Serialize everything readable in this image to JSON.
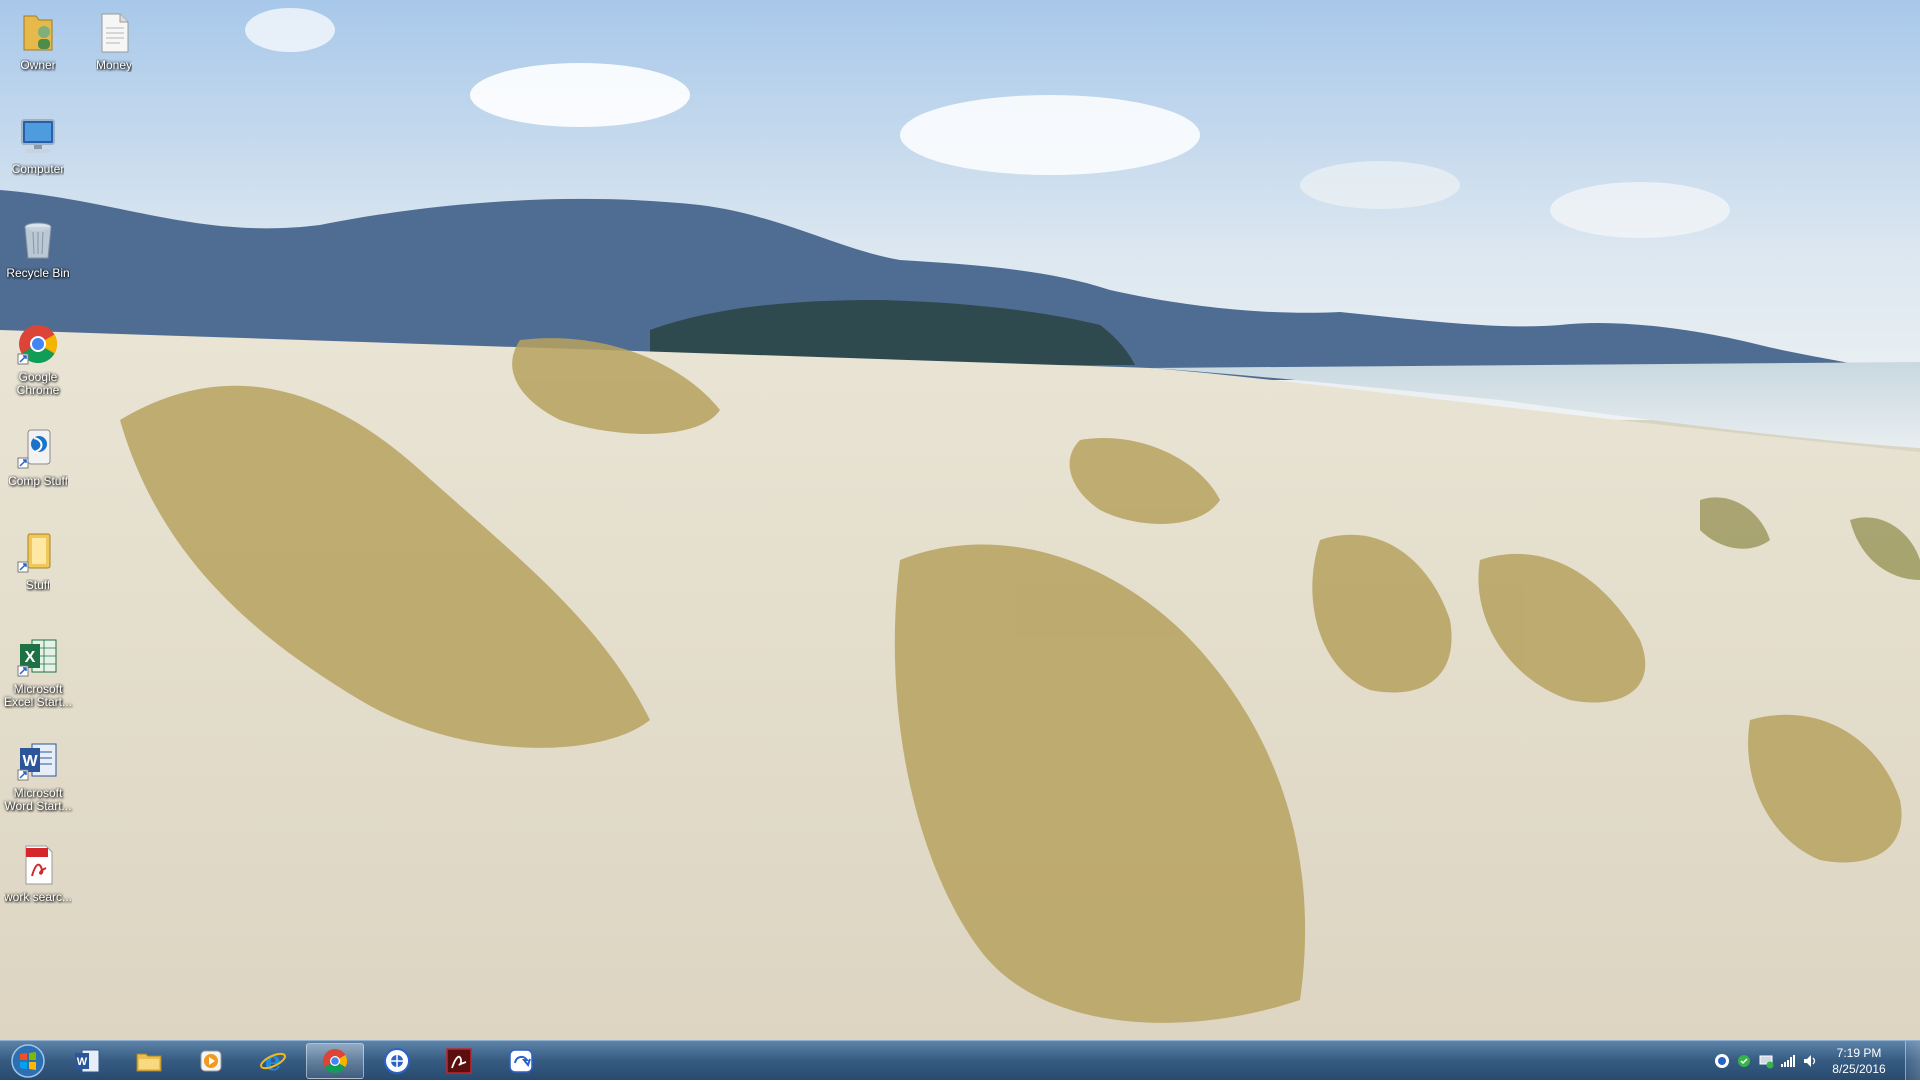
{
  "desktop": {
    "icons": [
      {
        "label": "Owner",
        "icon": "user-folder-icon"
      },
      {
        "label": "Money",
        "icon": "text-document-icon"
      },
      {
        "label": "Computer",
        "icon": "computer-icon"
      },
      {
        "label": "Recycle Bin",
        "icon": "recycle-bin-icon"
      },
      {
        "label": "Google Chrome",
        "icon": "chrome-icon"
      },
      {
        "label": "Comp Stuff",
        "icon": "shortcut-icon"
      },
      {
        "label": "Stuff",
        "icon": "folder-shortcut-icon"
      },
      {
        "label": "Microsoft Excel Start...",
        "icon": "excel-icon"
      },
      {
        "label": "Microsoft Word Start...",
        "icon": "word-icon"
      },
      {
        "label": "work searc...",
        "icon": "pdf-icon"
      }
    ]
  },
  "taskbar": {
    "pinned": [
      {
        "icon": "word-icon"
      },
      {
        "icon": "file-explorer-icon"
      },
      {
        "icon": "media-player-icon"
      },
      {
        "icon": "internet-explorer-icon"
      },
      {
        "icon": "chrome-icon",
        "active": true
      },
      {
        "icon": "blue-circle-app-icon"
      },
      {
        "icon": "acrobat-icon"
      },
      {
        "icon": "blue-square-app-icon"
      }
    ],
    "tray_icons": [
      "app-tray-icon",
      "green-tray-icon",
      "network-adapter-icon",
      "signal-bars-icon",
      "volume-icon"
    ],
    "clock": {
      "time": "7:19 PM",
      "date": "8/25/2016"
    }
  },
  "colors": {
    "taskbar": "#30567e",
    "sky": "#bcd7f0",
    "sand": "#ece6d6",
    "grass": "#b9a25e"
  }
}
